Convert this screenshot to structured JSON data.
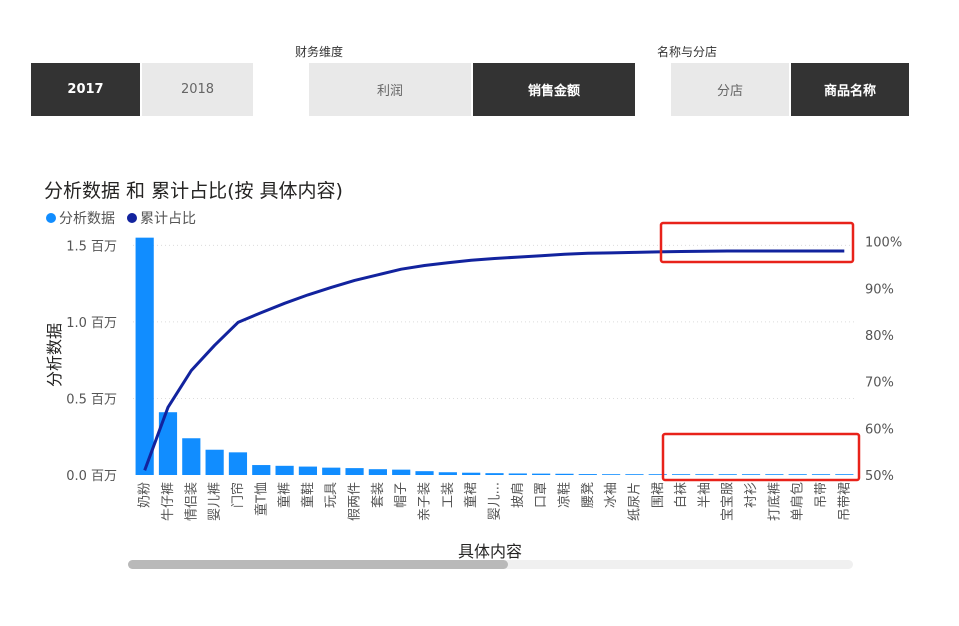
{
  "slicers": {
    "year": {
      "items": [
        {
          "label": "2017",
          "selected": true
        },
        {
          "label": "2018",
          "selected": false
        }
      ]
    },
    "finance": {
      "title": "财务维度",
      "items": [
        {
          "label": "利润",
          "selected": false
        },
        {
          "label": "销售金额",
          "selected": true
        }
      ]
    },
    "name": {
      "title": "名称与分店",
      "items": [
        {
          "label": "分店",
          "selected": false
        },
        {
          "label": "商品名称",
          "selected": true
        }
      ]
    }
  },
  "colors": {
    "bar": "#118DFF",
    "line": "#12239E",
    "highlight": "#E8221A",
    "selected_tile": "#333333",
    "unselected_tile": "#E9E9E9"
  },
  "chart_data": {
    "type": "bar",
    "title": "分析数据 和 累计占比(按 具体内容)",
    "xlabel": "具体内容",
    "ylabel": "分析数据",
    "legend_position": "top-left",
    "grid": true,
    "categories": [
      "奶粉",
      "牛仔裤",
      "情侣装",
      "婴儿裤",
      "门帘",
      "童T恤",
      "童裤",
      "童鞋",
      "玩具",
      "假两件",
      "套装",
      "帽子",
      "亲子装",
      "工装",
      "童裙",
      "婴儿...",
      "披肩",
      "口罩",
      "凉鞋",
      "腰凳",
      "冰袖",
      "纸尿片",
      "围裙",
      "白袜",
      "半袖",
      "宝宝服",
      "衬衫",
      "打底裤",
      "单肩包",
      "吊带",
      "吊带裙"
    ],
    "series": [
      {
        "name": "分析数据",
        "type": "bar",
        "axis": "left",
        "values": [
          1550000,
          410000,
          240000,
          165000,
          148000,
          65000,
          60000,
          55000,
          48000,
          45000,
          38000,
          35000,
          25000,
          18000,
          15000,
          12000,
          10000,
          9000,
          8000,
          6000,
          5000,
          4000,
          3000,
          2000,
          1500,
          1200,
          1000,
          800,
          600,
          400,
          300
        ]
      },
      {
        "name": "累计占比",
        "type": "line",
        "axis": "right",
        "values": [
          51,
          64.5,
          72.4,
          77.8,
          82.7,
          84.8,
          86.8,
          88.6,
          90.2,
          91.7,
          92.9,
          94.1,
          94.9,
          95.5,
          96.0,
          96.4,
          96.7,
          97.0,
          97.3,
          97.5,
          97.6,
          97.7,
          97.8,
          97.9,
          97.95,
          98.0,
          98.0,
          98.0,
          98.0,
          98.0,
          98.0
        ]
      }
    ],
    "y_left": {
      "ticks": [
        "0.0 百万",
        "0.5 百万",
        "1.0 百万",
        "1.5 百万"
      ],
      "tick_values": [
        0,
        500000,
        1000000,
        1500000
      ],
      "range": [
        0,
        1600000
      ]
    },
    "y_right": {
      "ticks": [
        "50%",
        "60%",
        "70%",
        "80%",
        "90%",
        "100%"
      ],
      "tick_values": [
        50,
        60,
        70,
        80,
        90,
        100
      ],
      "range": [
        50,
        102.5
      ]
    }
  }
}
